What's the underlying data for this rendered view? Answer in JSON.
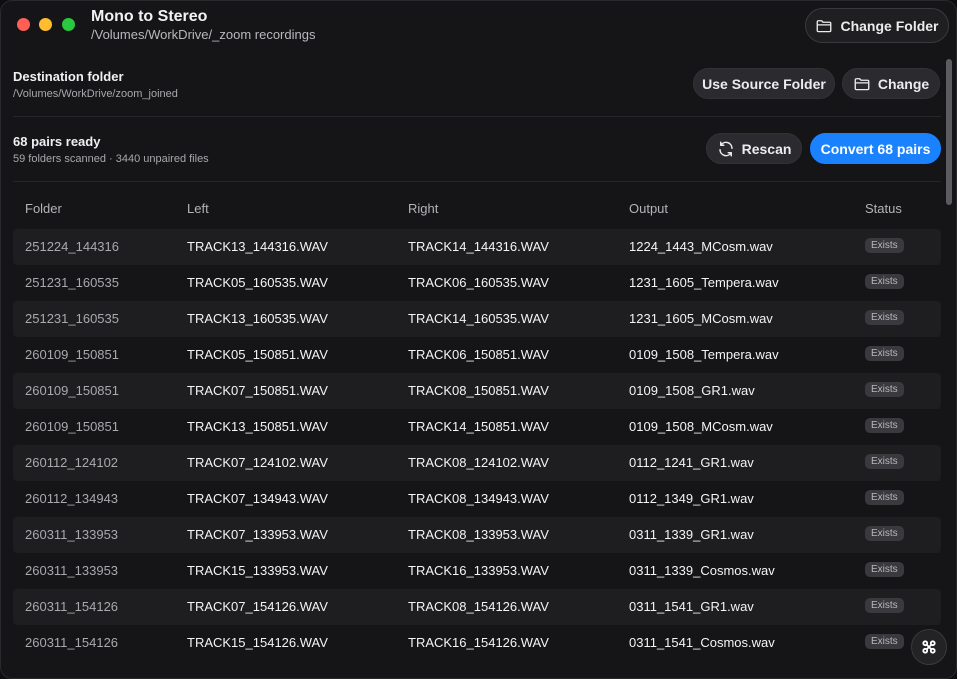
{
  "window": {
    "title": "Mono to Stereo",
    "source_path": "/Volumes/WorkDrive/_zoom recordings",
    "change_folder_label": "Change Folder"
  },
  "destination": {
    "label": "Destination folder",
    "path": "/Volumes/WorkDrive/zoom_joined",
    "use_source_label": "Use Source Folder",
    "change_label": "Change"
  },
  "summary": {
    "pairs_ready": "68 pairs ready",
    "details": "59 folders scanned · 3440 unpaired files",
    "rescan_label": "Rescan",
    "convert_label": "Convert 68 pairs"
  },
  "table": {
    "headers": {
      "folder": "Folder",
      "left": "Left",
      "right": "Right",
      "output": "Output",
      "status": "Status"
    },
    "rows": [
      {
        "folder": "251224_144316",
        "left": "TRACK13_144316.WAV",
        "right": "TRACK14_144316.WAV",
        "output": "1224_1443_MCosm.wav",
        "status": "Exists"
      },
      {
        "folder": "251231_160535",
        "left": "TRACK05_160535.WAV",
        "right": "TRACK06_160535.WAV",
        "output": "1231_1605_Tempera.wav",
        "status": "Exists"
      },
      {
        "folder": "251231_160535",
        "left": "TRACK13_160535.WAV",
        "right": "TRACK14_160535.WAV",
        "output": "1231_1605_MCosm.wav",
        "status": "Exists"
      },
      {
        "folder": "260109_150851",
        "left": "TRACK05_150851.WAV",
        "right": "TRACK06_150851.WAV",
        "output": "0109_1508_Tempera.wav",
        "status": "Exists"
      },
      {
        "folder": "260109_150851",
        "left": "TRACK07_150851.WAV",
        "right": "TRACK08_150851.WAV",
        "output": "0109_1508_GR1.wav",
        "status": "Exists"
      },
      {
        "folder": "260109_150851",
        "left": "TRACK13_150851.WAV",
        "right": "TRACK14_150851.WAV",
        "output": "0109_1508_MCosm.wav",
        "status": "Exists"
      },
      {
        "folder": "260112_124102",
        "left": "TRACK07_124102.WAV",
        "right": "TRACK08_124102.WAV",
        "output": "0112_1241_GR1.wav",
        "status": "Exists"
      },
      {
        "folder": "260112_134943",
        "left": "TRACK07_134943.WAV",
        "right": "TRACK08_134943.WAV",
        "output": "0112_1349_GR1.wav",
        "status": "Exists"
      },
      {
        "folder": "260311_133953",
        "left": "TRACK07_133953.WAV",
        "right": "TRACK08_133953.WAV",
        "output": "0311_1339_GR1.wav",
        "status": "Exists"
      },
      {
        "folder": "260311_133953",
        "left": "TRACK15_133953.WAV",
        "right": "TRACK16_133953.WAV",
        "output": "0311_1339_Cosmos.wav",
        "status": "Exists"
      },
      {
        "folder": "260311_154126",
        "left": "TRACK07_154126.WAV",
        "right": "TRACK08_154126.WAV",
        "output": "0311_1541_GR1.wav",
        "status": "Exists"
      },
      {
        "folder": "260311_154126",
        "left": "TRACK15_154126.WAV",
        "right": "TRACK16_154126.WAV",
        "output": "0311_1541_Cosmos.wav",
        "status": "Exists"
      }
    ]
  },
  "icons": {
    "folder": "folder-icon",
    "rescan": "refresh-icon",
    "floating": "apps-icon"
  },
  "colors": {
    "accent": "#1a82ff",
    "close": "#ff5f57",
    "minimize": "#febc2e",
    "zoom": "#28c840"
  }
}
